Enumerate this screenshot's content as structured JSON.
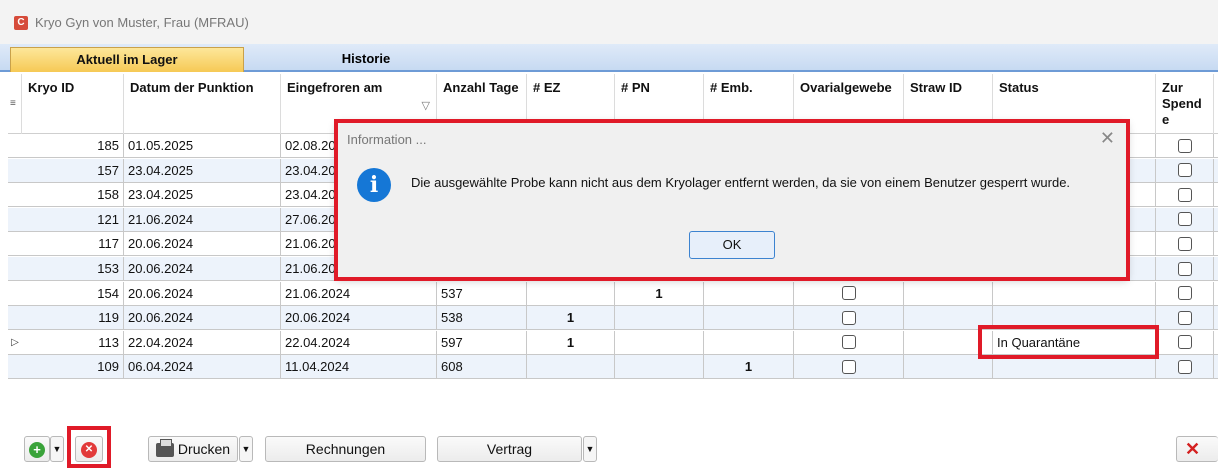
{
  "window": {
    "title": "Kryo Gyn von Muster, Frau (MFRAU)"
  },
  "tabs": [
    {
      "label": "Aktuell im Lager"
    },
    {
      "label": "Historie"
    }
  ],
  "columns": {
    "kryo_id": "Kryo ID",
    "datum": "Datum der Punktion",
    "eingefroren": "Eingefroren am",
    "anzahl": "Anzahl Tage",
    "ez": "# EZ",
    "pn": "# PN",
    "emb": "# Emb.",
    "ovar": "Ovarialgewebe",
    "straw": "Straw ID",
    "status": "Status",
    "spende_1": "Zur",
    "spende_2": "Spend",
    "spende_3": "e",
    "sort_icon": "▽"
  },
  "rows": [
    {
      "id": "185",
      "datum": "01.05.2025",
      "eingefroren": "02.08.20",
      "tage": "",
      "ez": "",
      "pn": "",
      "emb": "",
      "status": ""
    },
    {
      "id": "157",
      "datum": "23.04.2025",
      "eingefroren": "23.04.20",
      "tage": "",
      "ez": "",
      "pn": "",
      "emb": "",
      "status": ""
    },
    {
      "id": "158",
      "datum": "23.04.2025",
      "eingefroren": "23.04.20",
      "tage": "",
      "ez": "",
      "pn": "",
      "emb": "",
      "status": ""
    },
    {
      "id": "121",
      "datum": "21.06.2024",
      "eingefroren": "27.06.20",
      "tage": "",
      "ez": "",
      "pn": "",
      "emb": "",
      "status": ""
    },
    {
      "id": "117",
      "datum": "20.06.2024",
      "eingefroren": "21.06.20",
      "tage": "",
      "ez": "",
      "pn": "",
      "emb": "",
      "status": ""
    },
    {
      "id": "153",
      "datum": "20.06.2024",
      "eingefroren": "21.06.20",
      "tage": "",
      "ez": "",
      "pn": "",
      "emb": "",
      "status": ""
    },
    {
      "id": "154",
      "datum": "20.06.2024",
      "eingefroren": "21.06.2024",
      "tage": "537",
      "ez": "",
      "pn": "1",
      "emb": "",
      "status": ""
    },
    {
      "id": "119",
      "datum": "20.06.2024",
      "eingefroren": "20.06.2024",
      "tage": "538",
      "ez": "1",
      "pn": "",
      "emb": "",
      "status": ""
    },
    {
      "id": "113",
      "datum": "22.04.2024",
      "eingefroren": "22.04.2024",
      "tage": "597",
      "ez": "1",
      "pn": "",
      "emb": "",
      "status": "In Quarantäne"
    },
    {
      "id": "109",
      "datum": "06.04.2024",
      "eingefroren": "11.04.2024",
      "tage": "608",
      "ez": "",
      "pn": "",
      "emb": "1",
      "status": ""
    }
  ],
  "dialog": {
    "title": "Information ...",
    "close_glyph": "✕",
    "icon_glyph": "i",
    "message": "Die ausgewählte Probe kann nicht aus dem Kryolager entfernt werden, da sie von einem Benutzer gesperrt wurde.",
    "ok_label": "OK"
  },
  "toolbar": {
    "add_glyph": "+",
    "delete_glyph": "✕",
    "dropdown_glyph": "▼",
    "print_label": "Drucken",
    "rechnungen_label": "Rechnungen",
    "vertrag_label": "Vertrag",
    "close_glyph": "✕"
  },
  "colors": {
    "highlight": "#e01a28",
    "tab_active": "#f6c955",
    "info_icon": "#1577d6"
  }
}
